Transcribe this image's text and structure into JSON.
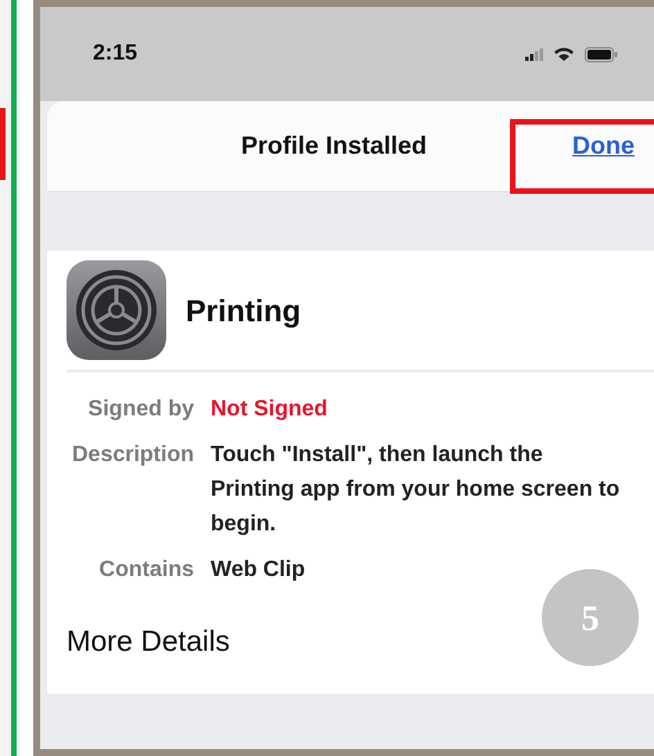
{
  "previous_screenshot": {
    "highlighted": true
  },
  "status_bar": {
    "time": "2:15"
  },
  "sheet": {
    "title": "Profile Installed",
    "done_button": {
      "label": "Done",
      "highlighted": true
    }
  },
  "profile": {
    "name": "Printing",
    "details": [
      {
        "label": "Signed by",
        "value": "Not Signed",
        "kind": "warning"
      },
      {
        "label": "Description",
        "value": "Touch \"Install\", then launch the Printing app from your home screen to begin.",
        "kind": "plain"
      },
      {
        "label": "Contains",
        "value": "Web Clip",
        "kind": "plain"
      }
    ],
    "more_details": "More Details"
  },
  "step_badge": "5"
}
